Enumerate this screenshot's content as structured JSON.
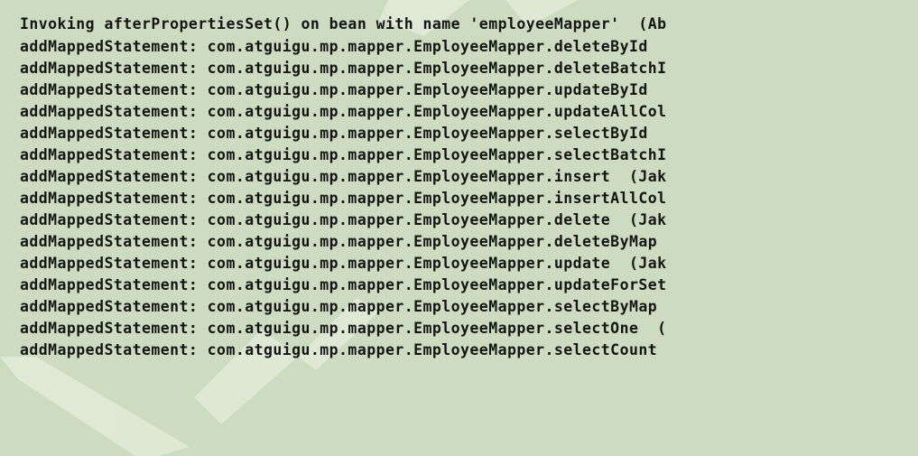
{
  "console": {
    "lines": [
      "Invoking afterPropertiesSet() on bean with name 'employeeMapper'  (Ab",
      "addMappedStatement: com.atguigu.mp.mapper.EmployeeMapper.deleteById",
      "addMappedStatement: com.atguigu.mp.mapper.EmployeeMapper.deleteBatchI",
      "addMappedStatement: com.atguigu.mp.mapper.EmployeeMapper.updateById",
      "addMappedStatement: com.atguigu.mp.mapper.EmployeeMapper.updateAllCol",
      "addMappedStatement: com.atguigu.mp.mapper.EmployeeMapper.selectById",
      "addMappedStatement: com.atguigu.mp.mapper.EmployeeMapper.selectBatchI",
      "addMappedStatement: com.atguigu.mp.mapper.EmployeeMapper.insert  (Jak",
      "addMappedStatement: com.atguigu.mp.mapper.EmployeeMapper.insertAllCol",
      "addMappedStatement: com.atguigu.mp.mapper.EmployeeMapper.delete  (Jak",
      "addMappedStatement: com.atguigu.mp.mapper.EmployeeMapper.deleteByMap",
      "addMappedStatement: com.atguigu.mp.mapper.EmployeeMapper.update  (Jak",
      "addMappedStatement: com.atguigu.mp.mapper.EmployeeMapper.updateForSet",
      "addMappedStatement: com.atguigu.mp.mapper.EmployeeMapper.selectByMap",
      "addMappedStatement: com.atguigu.mp.mapper.EmployeeMapper.selectOne  (",
      "addMappedStatement: com.atguigu.mp.mapper.EmployeeMapper.selectCount"
    ]
  },
  "colors": {
    "background": "#cddcc0",
    "text": "#151515",
    "watermark": "#e4ecdc"
  }
}
